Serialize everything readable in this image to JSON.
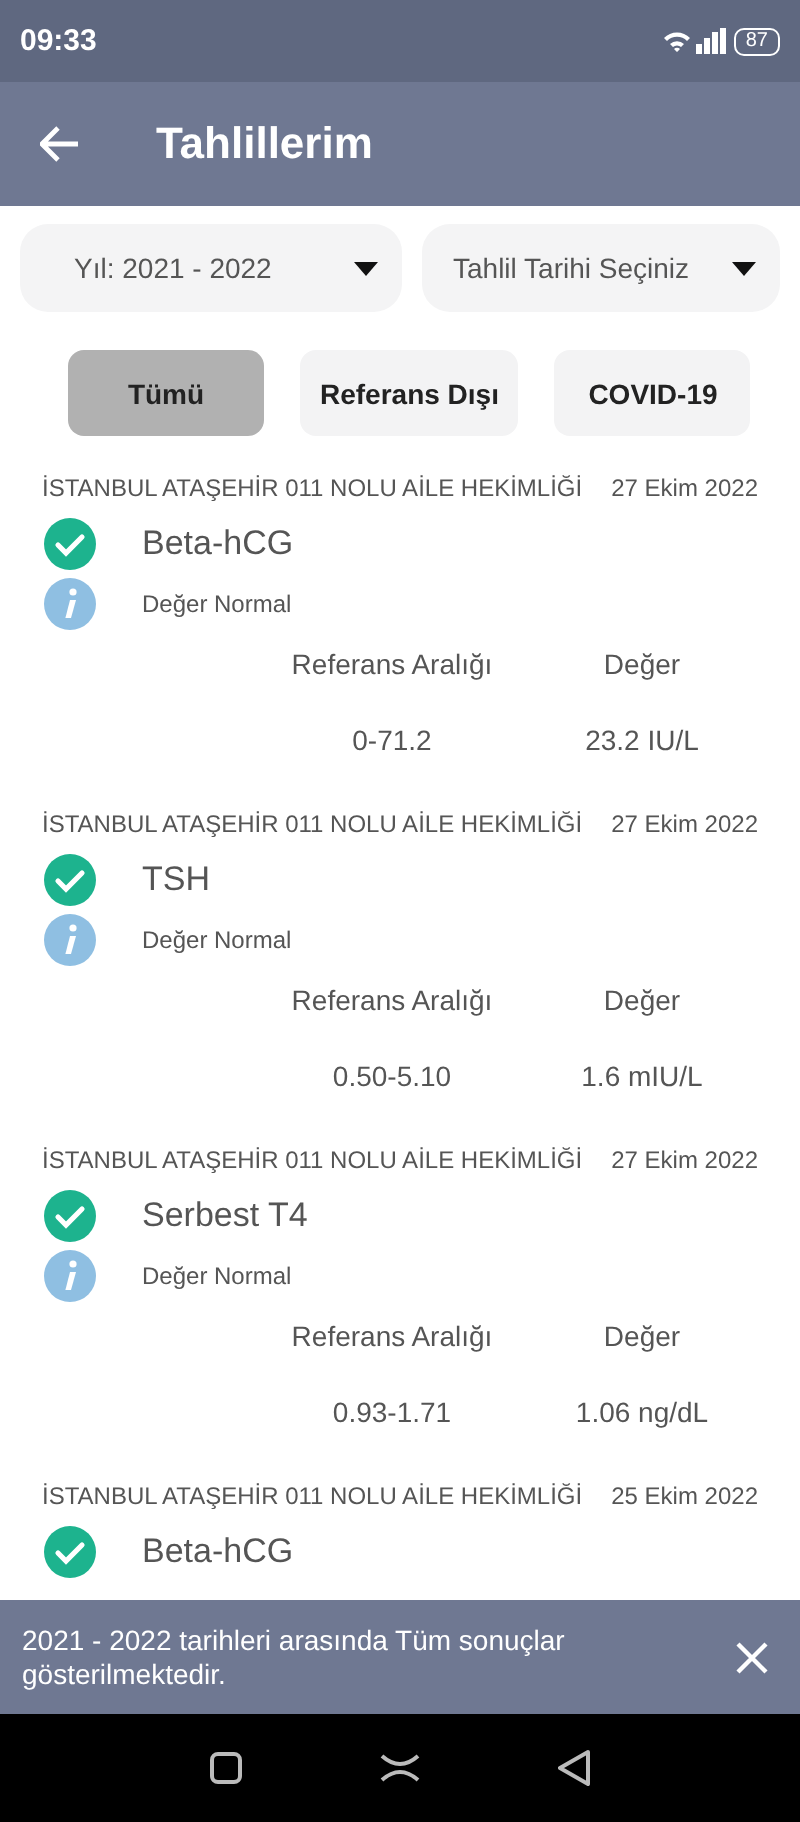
{
  "status_bar": {
    "time": "09:33",
    "battery": "87"
  },
  "app_bar": {
    "title": "Tahlillerim"
  },
  "filters": [
    {
      "label": "Yıl: 2021 - 2022"
    },
    {
      "label": "Tahlil Tarihi Seçiniz"
    }
  ],
  "chips": [
    {
      "label": "Tümü",
      "selected": true
    },
    {
      "label": "Referans Dışı",
      "selected": false
    },
    {
      "label": "COVID-19",
      "selected": false
    }
  ],
  "results": [
    {
      "clinic": "İSTANBUL ATAŞEHİR 011 NOLU AİLE HEKİMLİĞİ",
      "date": "27 Ekim 2022",
      "test": "Beta-hCG",
      "status": "Değer Normal",
      "range_label": "Referans Aralığı",
      "value_label": "Değer",
      "range": "0-71.2",
      "value": "23.2 IU/L"
    },
    {
      "clinic": "İSTANBUL ATAŞEHİR 011 NOLU AİLE HEKİMLİĞİ",
      "date": "27 Ekim 2022",
      "test": "TSH",
      "status": "Değer Normal",
      "range_label": "Referans Aralığı",
      "value_label": "Değer",
      "range": "0.50-5.10",
      "value": "1.6 mIU/L"
    },
    {
      "clinic": "İSTANBUL ATAŞEHİR 011 NOLU AİLE HEKİMLİĞİ",
      "date": "27 Ekim 2022",
      "test": "Serbest T4",
      "status": "Değer Normal",
      "range_label": "Referans Aralığı",
      "value_label": "Değer",
      "range": "0.93-1.71",
      "value": "1.06 ng/dL"
    },
    {
      "clinic": "İSTANBUL ATAŞEHİR 011 NOLU AİLE HEKİMLİĞİ",
      "date": "25 Ekim 2022",
      "test": "Beta-hCG"
    }
  ],
  "snackbar": {
    "message": "2021 - 2022 tarihleri arasında Tüm sonuçlar gösterilmektedir."
  }
}
